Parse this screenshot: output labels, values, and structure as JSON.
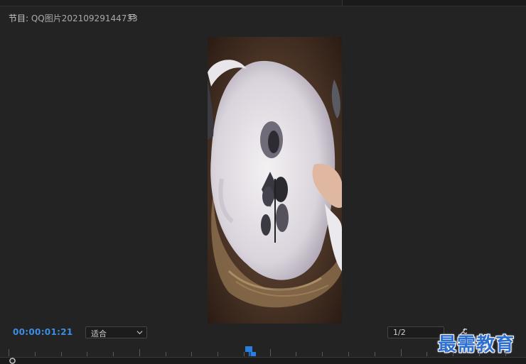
{
  "panel": {
    "title_prefix": "节目: ",
    "sequence_name": "QQ图片20210929144733",
    "menu_icon": "hamburger-menu-icon"
  },
  "program": {
    "timecode": "00:00:01:21",
    "fit_value": "适合",
    "resolution_value": "1/2"
  },
  "watermark": {
    "text": "最需教育"
  },
  "colors": {
    "timecode": "#3d8ee2",
    "playhead": "#2a7de1",
    "background": "#232323",
    "watermark": "#2f6fd0"
  },
  "icons": {
    "fit_dropdown": "chevron-down-icon",
    "settings": "wrench-icon",
    "playhead": "playhead-marker-icon",
    "scroll_handle": "circle-handle-icon"
  }
}
